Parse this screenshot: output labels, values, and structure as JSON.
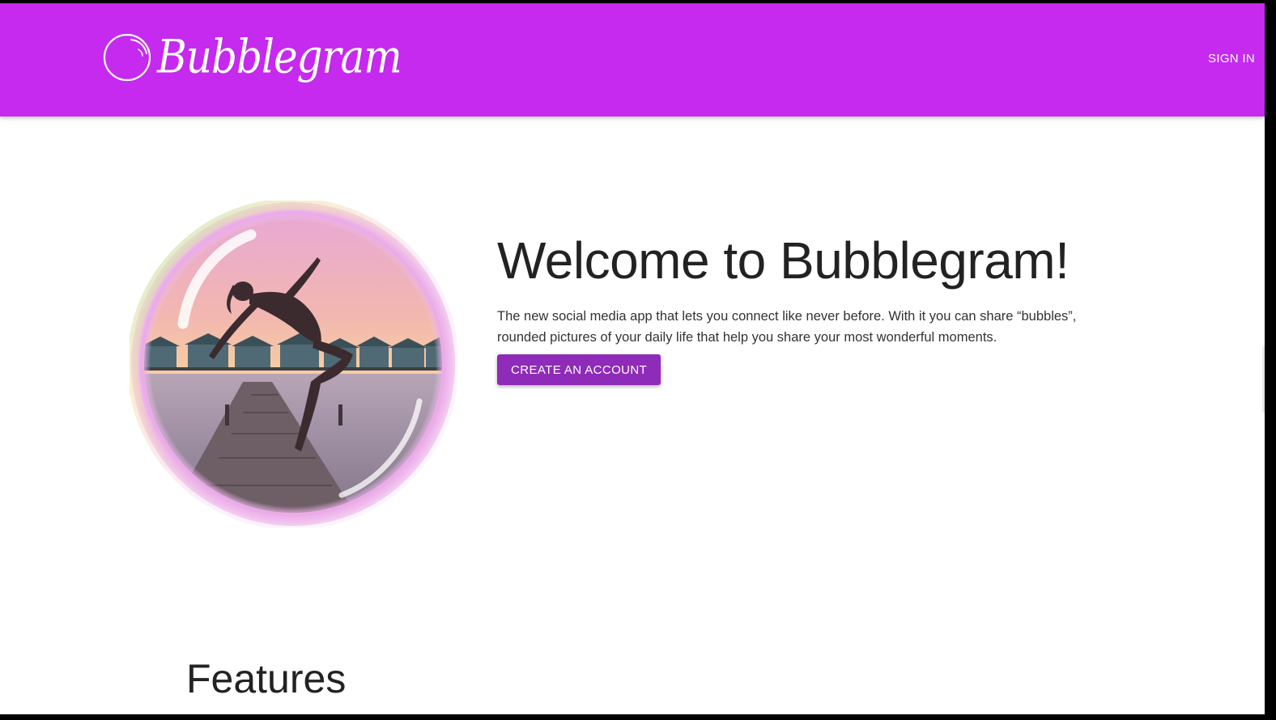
{
  "header": {
    "brand_name": "Bubblegram",
    "logo_icon": "bubble-icon",
    "sign_in_label": "SIGN IN",
    "background_color": "#c52aee"
  },
  "hero": {
    "image_description_icon": "bubble-photo",
    "title": "Welcome to Bubblegram!",
    "description": "The new social media app that lets you connect like never before. With it you can share “bubbles”, rounded pictures of your daily life that help you share your most wonderful moments.",
    "cta_label": "CREATE AN ACCOUNT",
    "cta_color": "#8e2bb8"
  },
  "features": {
    "heading": "Features"
  }
}
